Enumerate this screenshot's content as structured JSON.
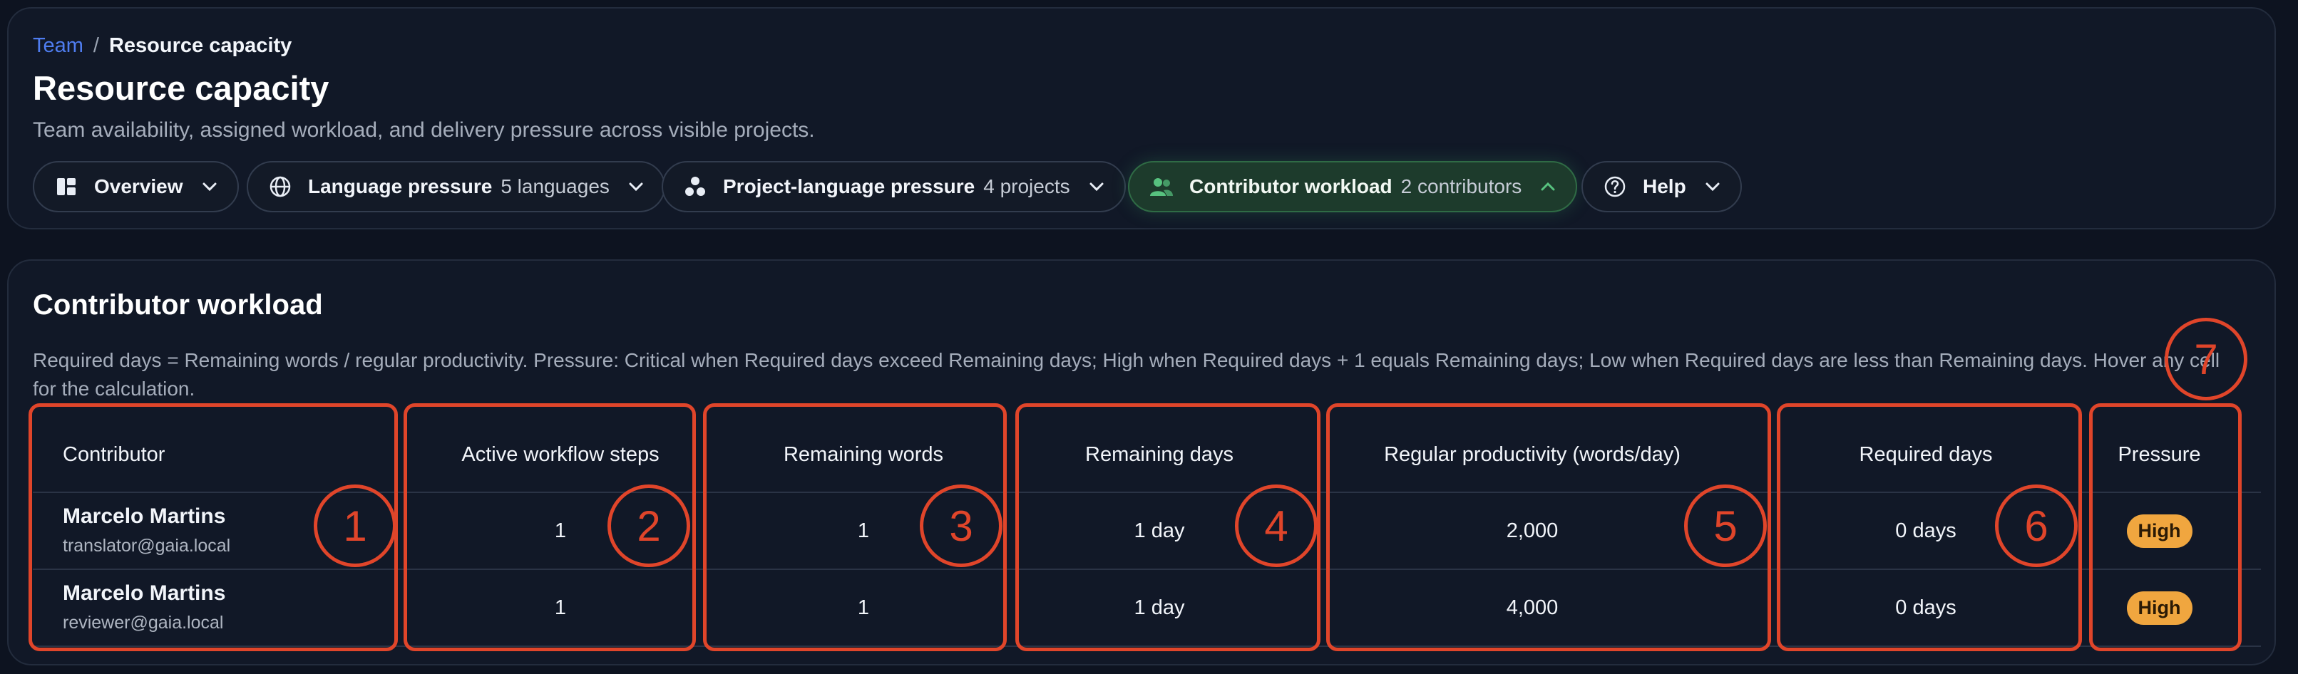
{
  "breadcrumb": {
    "parent": "Team",
    "separator": "/",
    "current": "Resource capacity"
  },
  "page": {
    "title": "Resource capacity",
    "subtitle": "Team availability, assigned workload, and delivery pressure across visible projects."
  },
  "pills": [
    {
      "label": "Overview",
      "meta": "",
      "icon": "dashboard-icon",
      "chevron": "down"
    },
    {
      "label": "Language pressure",
      "meta": "5 languages",
      "icon": "globe-icon",
      "chevron": "down"
    },
    {
      "label": "Project-language pressure",
      "meta": "4 projects",
      "icon": "cluster-icon",
      "chevron": "down"
    },
    {
      "label": "Contributor workload",
      "meta": "2 contributors",
      "icon": "users-icon",
      "chevron": "up",
      "active": true
    },
    {
      "label": "Help",
      "meta": "",
      "icon": "help-icon",
      "chevron": "down"
    }
  ],
  "section": {
    "title": "Contributor workload",
    "description": "Required days = Remaining words / regular productivity. Pressure: Critical when Required days exceed Remaining days; High when Required days + 1 equals Remaining days; Low when Required days are less than Remaining days. Hover any cell for the calculation."
  },
  "table": {
    "headers": [
      "Contributor",
      "Active workflow steps",
      "Remaining words",
      "Remaining days",
      "Regular productivity (words/day)",
      "Required days",
      "Pressure"
    ],
    "rows": [
      {
        "name": "Marcelo Martins",
        "email": "translator@gaia.local",
        "steps": "1",
        "words": "1",
        "days": "1 day",
        "productivity": "2,000",
        "required": "0 days",
        "pressure": "High"
      },
      {
        "name": "Marcelo Martins",
        "email": "reviewer@gaia.local",
        "steps": "1",
        "words": "1",
        "days": "1 day",
        "productivity": "4,000",
        "required": "0 days",
        "pressure": "High"
      }
    ]
  },
  "annotations": [
    "1",
    "2",
    "3",
    "4",
    "5",
    "6",
    "7"
  ],
  "colors": {
    "accent_link": "#4f7df0",
    "active_pill": "#1d3b2c",
    "badge_high": "#f0a63f",
    "annotation": "#e0452a"
  }
}
